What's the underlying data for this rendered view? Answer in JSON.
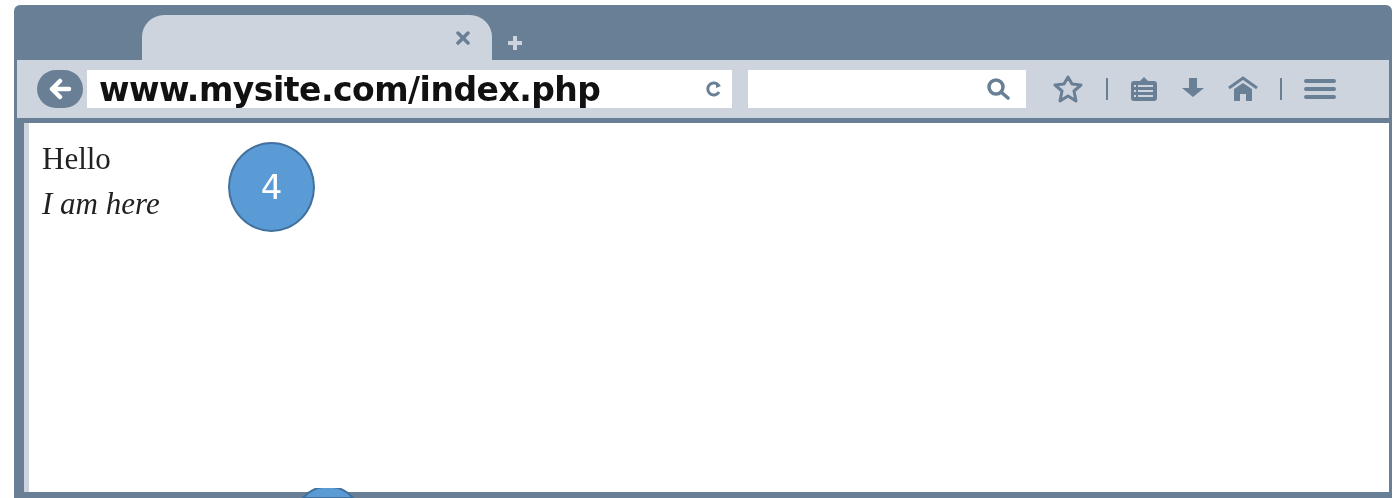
{
  "browser": {
    "address": "www.mysite.com/index.php",
    "page": {
      "lines": [
        {
          "text": "Hello",
          "kind": "plain"
        },
        {
          "text": "I am here",
          "kind": "emphasis"
        }
      ]
    }
  },
  "annotations": [
    {
      "kind": "numbered",
      "label": "4"
    },
    {
      "kind": "partial"
    }
  ]
}
